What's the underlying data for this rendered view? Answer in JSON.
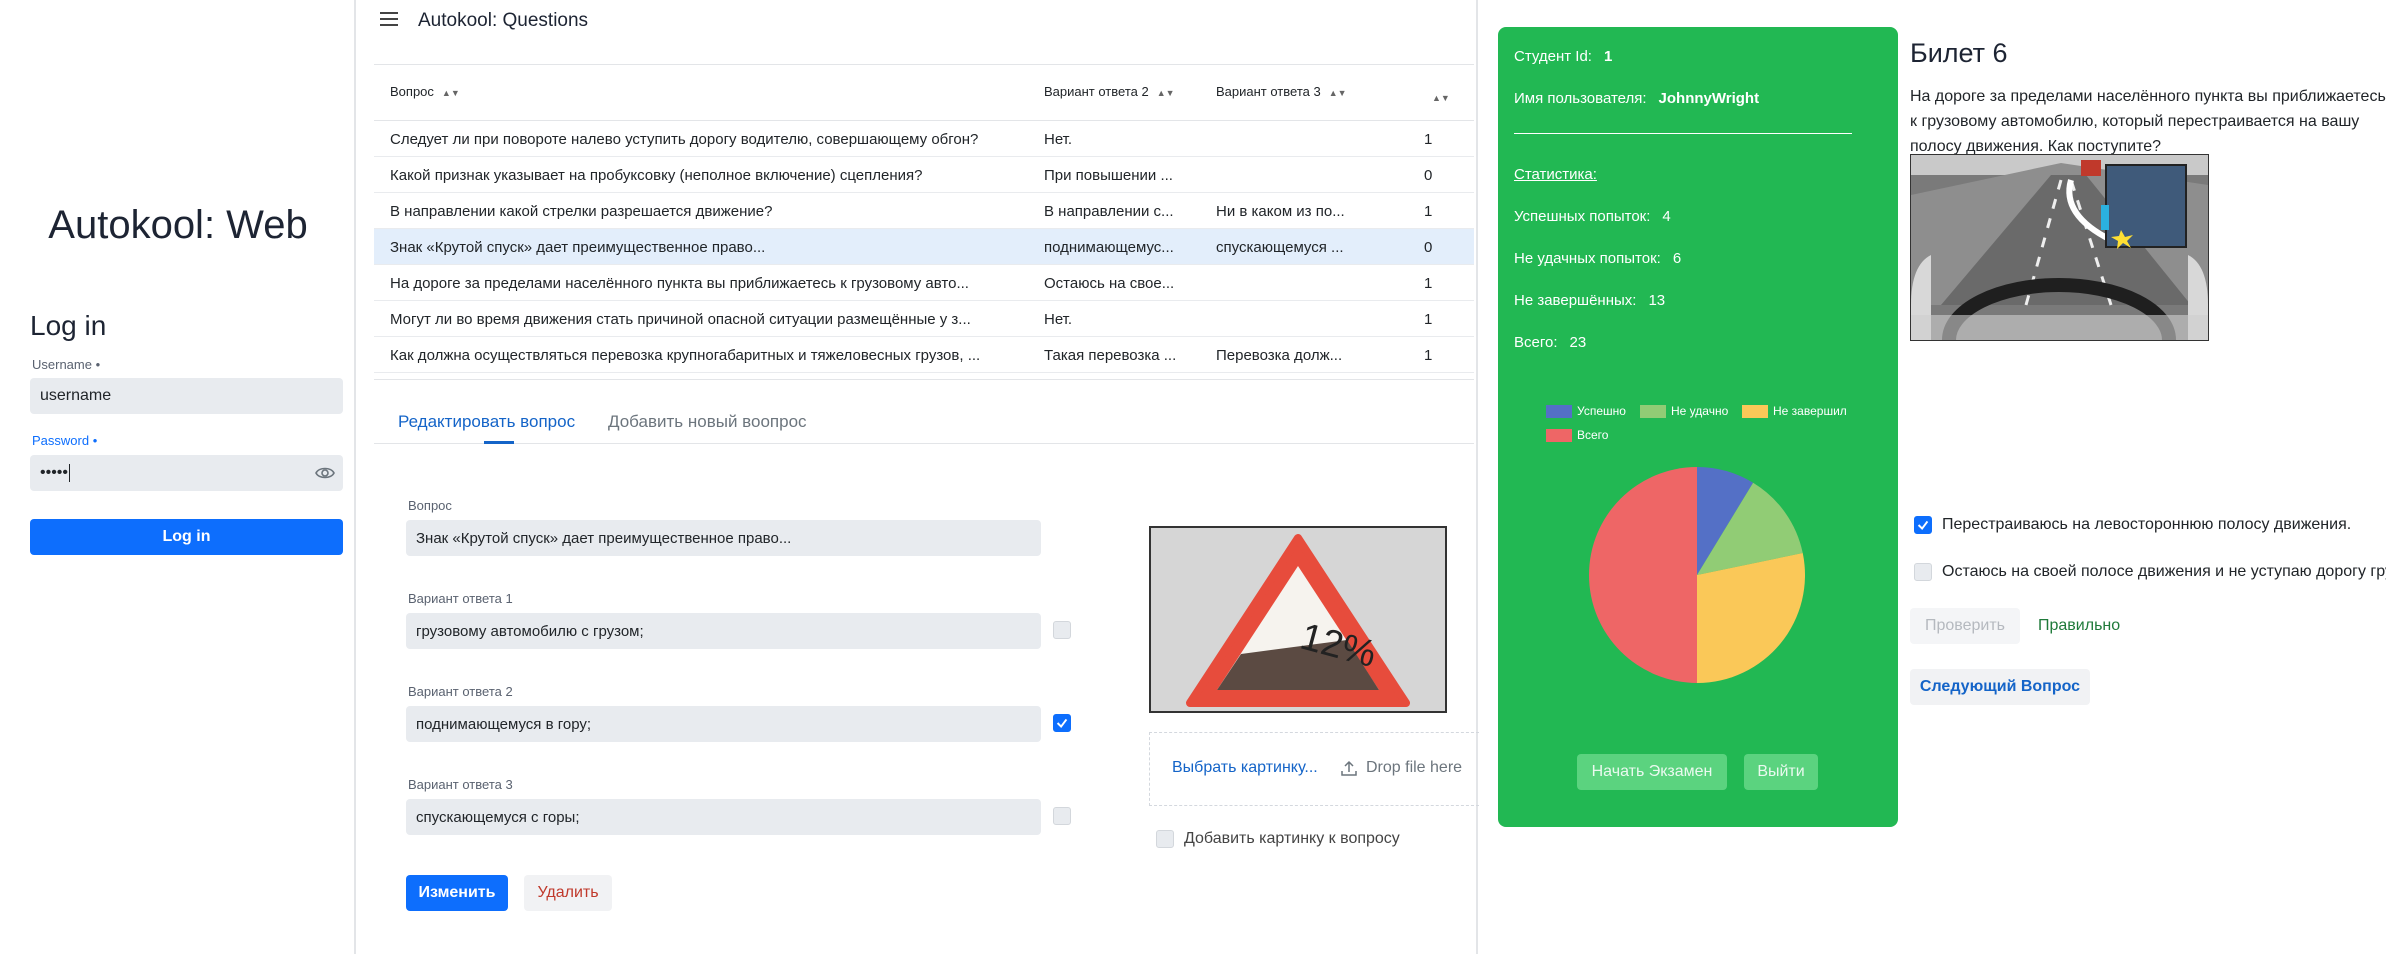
{
  "login": {
    "app_title": "Autokool: Web",
    "heading": "Log in",
    "username_label": "Username •",
    "username_value": "username",
    "password_label": "Password •",
    "password_value": "•••••",
    "submit_label": "Log in"
  },
  "admin": {
    "page_title": "Autokool: Questions",
    "columns": [
      "Вопрос",
      "Вариант ответа 2",
      "Вариант ответа 3",
      ""
    ],
    "rows": [
      {
        "question": "Следует ли при повороте налево уступить дорогу водителю, совершающему обгон?",
        "a2": "Нет.",
        "a3": "",
        "n": "1"
      },
      {
        "question": "Какой признак указывает на пробуксовку (неполное включение) сцепления?",
        "a2": "При повышении ...",
        "a3": "",
        "n": "0"
      },
      {
        "question": "В направлении какой стрелки разрешается движение?",
        "a2": "В направлении с...",
        "a3": "Ни в каком из по...",
        "n": "1"
      },
      {
        "question": "Знак «Крутой спуск» дает преимущественное право...",
        "a2": "поднимающемус...",
        "a3": "спускающемуся ...",
        "n": "0"
      },
      {
        "question": "На дороге за пределами населённого пункта вы приближаетесь к грузовому авто...",
        "a2": "Остаюсь на свое...",
        "a3": "",
        "n": "1"
      },
      {
        "question": "Могут ли во время движения стать причиной опасной ситуации размещённые у з...",
        "a2": "Нет.",
        "a3": "",
        "n": "1"
      },
      {
        "question": "Как должна осуществляться перевозка крупногабаритных и тяжеловесных грузов, ...",
        "a2": "Такая перевозка ...",
        "a3": "Перевозка долж...",
        "n": "1"
      }
    ],
    "tabs": [
      "Редактировать вопрос",
      "Добавить новый воопрос"
    ],
    "form": {
      "question_label": "Вопрос",
      "question_value": "Знак «Крутой спуск» дает преимущественное право...",
      "answers": [
        {
          "label": "Вариант ответа 1",
          "value": "грузовому автомобилю с грузом;",
          "correct": false
        },
        {
          "label": "Вариант ответа 2",
          "value": "поднимающемуся в гору;",
          "correct": true
        },
        {
          "label": "Вариант ответа 3",
          "value": "спускающемуся с горы;",
          "correct": false
        }
      ],
      "sign_text": "12%",
      "choose_image": "Выбрать картинку...",
      "drop_file": "Drop file here",
      "add_image_label": "Добавить картинку к вопросу",
      "save_label": "Изменить",
      "delete_label": "Удалить"
    }
  },
  "student": {
    "id_label": "Студент Id:",
    "id_value": "1",
    "user_label": "Имя пользователя:",
    "user_value": "JohnnyWright",
    "stats_label": "Статистика:",
    "success_label": "Успешных попыток:",
    "success_value": "4",
    "fail_label": "Не удачных попыток:",
    "fail_value": "6",
    "unfinished_label": "Не завершённых:",
    "unfinished_value": "13",
    "total_label": "Всего:",
    "total_value": "23",
    "start_exam": "Начать Экзамен",
    "logout": "Выйти"
  },
  "chart_data": {
    "type": "pie",
    "labels": [
      "Успешно",
      "Не удачно",
      "Не завершил",
      "Всего"
    ],
    "values": [
      4,
      6,
      13,
      23
    ],
    "colors": [
      "#5470c6",
      "#91cc75",
      "#fac858",
      "#ee6666"
    ],
    "legend": "top-left"
  },
  "ticket": {
    "title": "Билет 6",
    "question": "На дороге за пределами населённого пункта вы приближаетесь к грузовому автомобилю, который перестраивается на вашу полосу движения. Как поступите?",
    "answers": [
      {
        "text": "Перестраиваюсь на левостороннюю полосу движения.",
        "checked": true
      },
      {
        "text": "Остаюсь на своей полосе движения и не уступаю дорогу грузовому автомобилю.",
        "checked": false
      }
    ],
    "check_label": "Проверить",
    "result": "Правильно",
    "next_label": "Следующий Вопрос"
  },
  "colors": {
    "primary": "#0d6efd",
    "student_panel": "#22b853",
    "selected_row": "#e3eefb",
    "input_bg": "#e8ebef"
  }
}
